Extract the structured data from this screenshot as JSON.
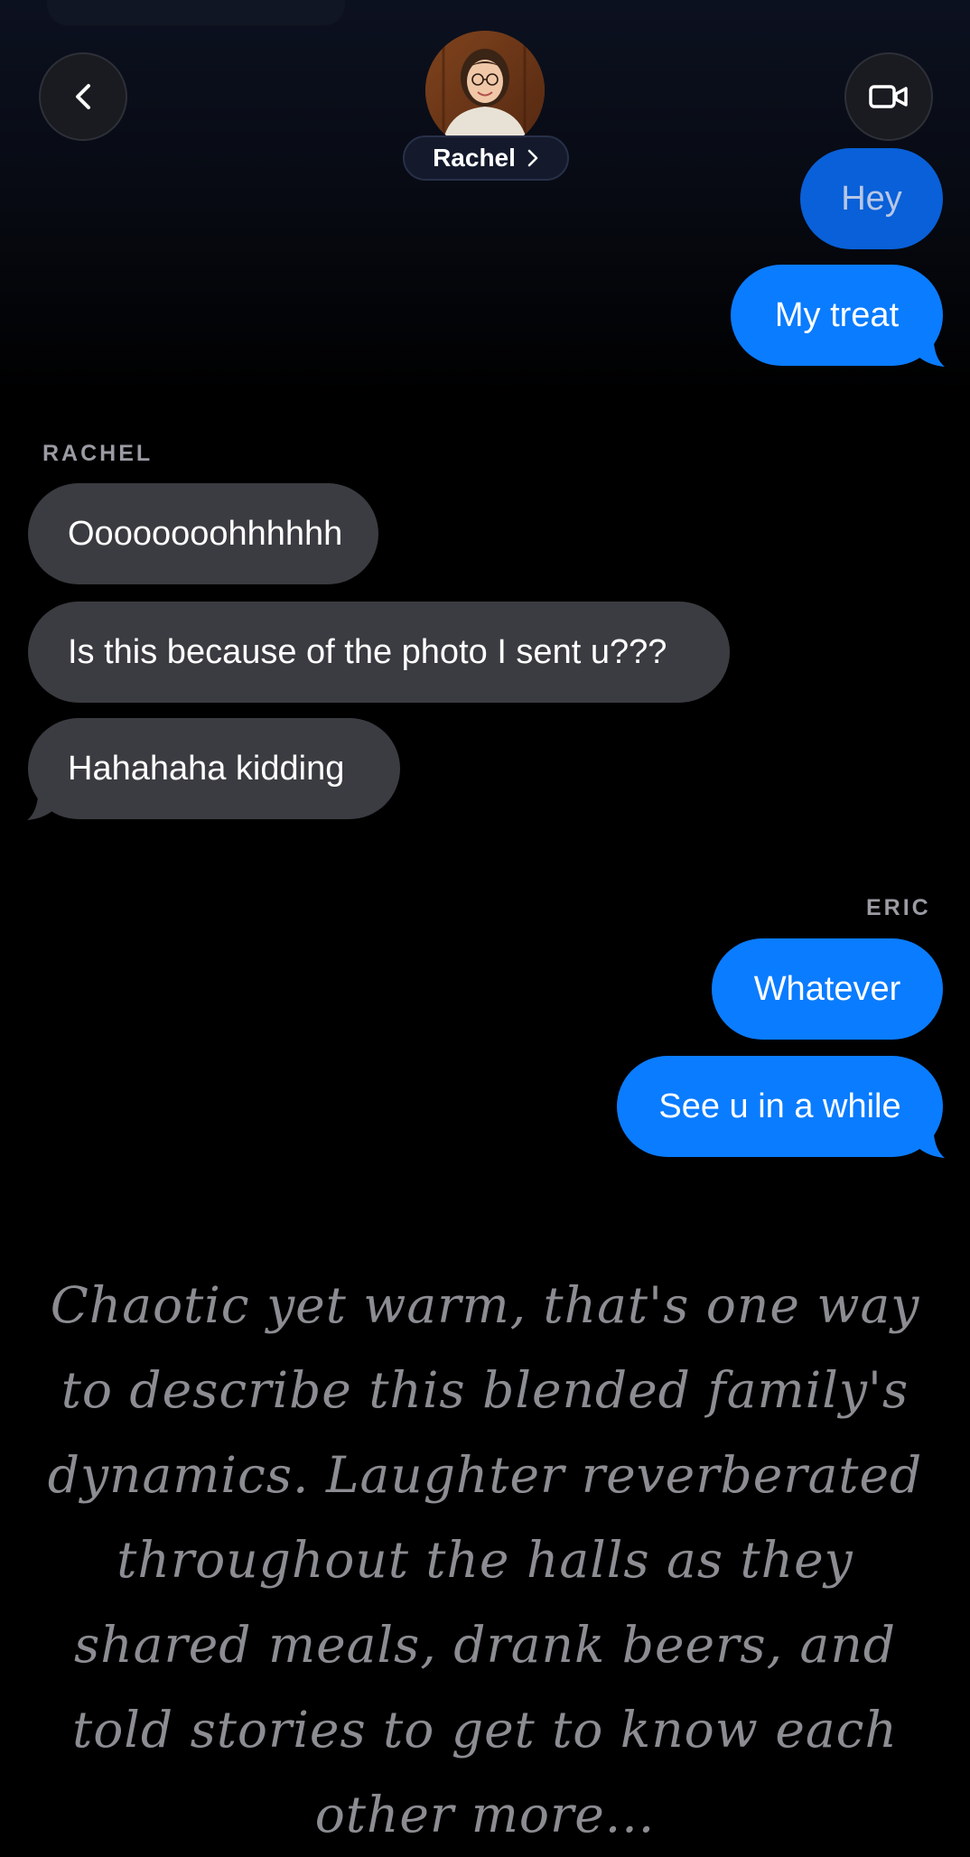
{
  "header": {
    "back_icon": "chevron-left-icon",
    "video_icon": "video-camera-icon",
    "contact_name": "Rachel",
    "contact_chevron_icon": "chevron-right-icon"
  },
  "messages": [
    {
      "sender": "me",
      "text": "Hey"
    },
    {
      "sender": "me",
      "text": "My treat"
    },
    {
      "sender_label": "RACHEL"
    },
    {
      "sender": "rachel",
      "text": "Oooooooohhhhhh"
    },
    {
      "sender": "rachel",
      "text": "Is this because of the photo I sent u???"
    },
    {
      "sender": "rachel",
      "text": "Hahahaha kidding"
    },
    {
      "sender_label": "ERIC"
    },
    {
      "sender": "me",
      "text": "Whatever"
    },
    {
      "sender": "me",
      "text": "See u in a while"
    }
  ],
  "narration": "Chaotic yet warm, that's one way to describe this blended family's dynamics. Laughter reverberated throughout the halls as they shared meals, drank beers, and told stories to get to know each other more...",
  "colors": {
    "outgoing_bubble": "#0a7cff",
    "incoming_bubble": "#3b3c41",
    "background": "#000000",
    "narration_text": "#8c8d92"
  }
}
